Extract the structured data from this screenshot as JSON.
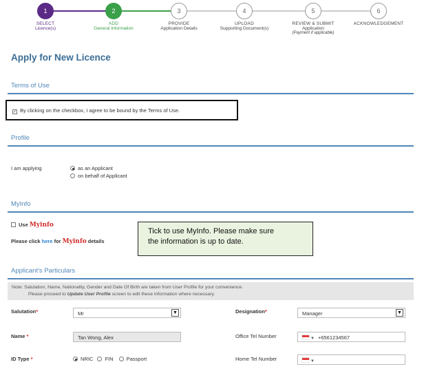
{
  "stepper": [
    {
      "num": "1",
      "label1": "SELECT",
      "label2": "Licence(s)",
      "label3": "",
      "state": "done"
    },
    {
      "num": "2",
      "label1": "ADD",
      "label2": "General Information",
      "label3": "",
      "state": "active"
    },
    {
      "num": "3",
      "label1": "PROVIDE",
      "label2": "Application Details",
      "label3": "",
      "state": "todo"
    },
    {
      "num": "4",
      "label1": "UPLOAD",
      "label2": "Supporting Document(s)",
      "label3": "",
      "state": "todo"
    },
    {
      "num": "5",
      "label1": "REVIEW & SUBMIT",
      "label2": "Application",
      "label3": "(Payment if applicable)",
      "state": "todo"
    },
    {
      "num": "6",
      "label1": "ACKNOWLEDGEMENT",
      "label2": "",
      "label3": "",
      "state": "todo"
    }
  ],
  "page_title": "Apply for New Licence",
  "terms": {
    "section_title": "Terms of Use",
    "checkbox_label": "By clicking on the checkbox, I agree to be bound by the Terms of Use."
  },
  "profile": {
    "section_title": "Profile",
    "label": "I am applying",
    "options": [
      "as an Applicant",
      "on behalf of Applicant"
    ]
  },
  "myinfo": {
    "section_title": "MyInfo",
    "use_label": "Use",
    "logo_text": "Myinfo",
    "click_prefix": "Please click",
    "here_link": "here",
    "click_for": "for",
    "click_suffix": "details",
    "callout_line1": "Tick to use MyInfo. Please make sure",
    "callout_line2": "the information is up to date."
  },
  "particulars": {
    "section_title": "Applicant's Particulars",
    "note_line1": "Note: Salutation, Name, Nationality, Gender and Date Of Birth are taken from User Profile for your convenience.",
    "note_line2_prefix": "Please proceed to",
    "note_line2_link": "Update User Profile",
    "note_line2_suffix": "screen to edit these information where necessary.",
    "salutation_label": "Salutation",
    "salutation_value": "Mr",
    "designation_label": "Designation",
    "designation_value": "Manager",
    "name_label": "Name",
    "name_value": "Tan Wong, Alex",
    "office_tel_label": "Office Tel Number",
    "office_tel_value": "+6561234567",
    "id_type_label": "ID Type",
    "id_type_options": [
      "NRIC",
      "FIN",
      "Passport"
    ],
    "home_tel_label": "Home Tel Number",
    "required_mark": "*"
  }
}
